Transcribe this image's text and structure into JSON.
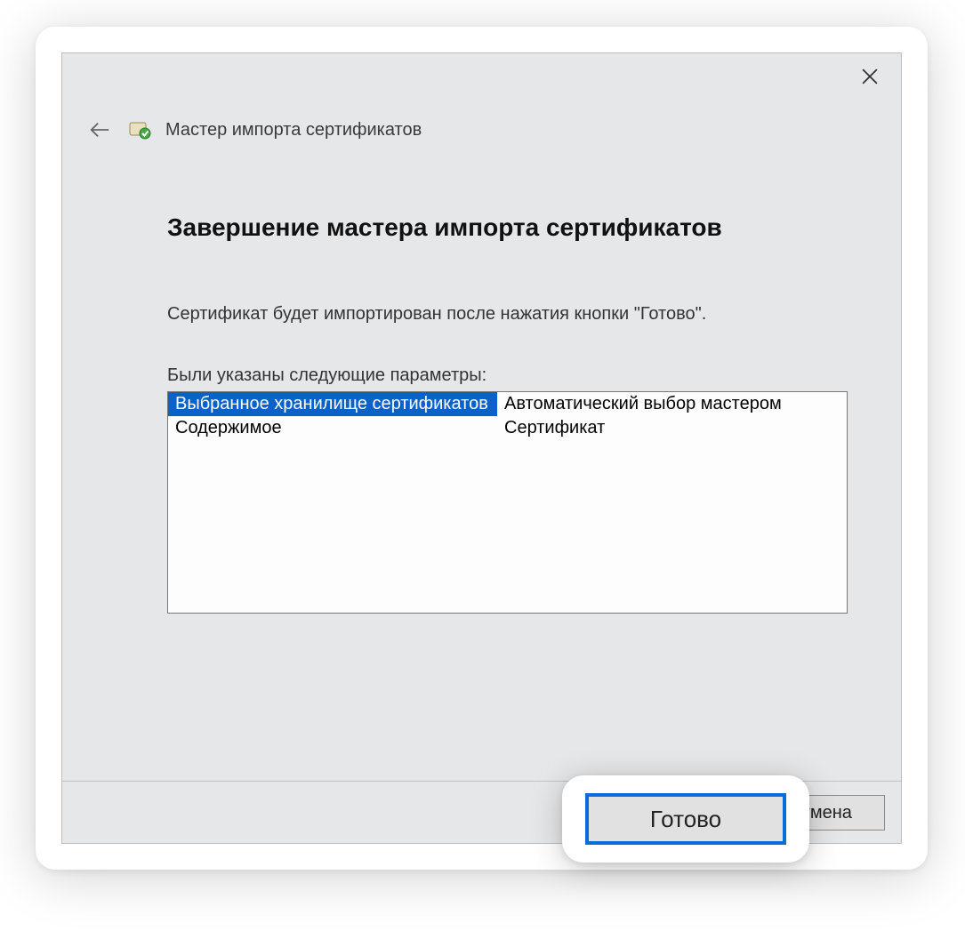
{
  "wizard": {
    "title": "Мастер импорта сертификатов",
    "heading": "Завершение мастера импорта сертификатов",
    "description": "Сертификат будет импортирован после нажатия кнопки \"Готово\".",
    "params_label": "Были указаны следующие параметры:",
    "params": [
      {
        "key": "Выбранное хранилище сертификатов",
        "value": "Автоматический выбор мастером",
        "selected": true
      },
      {
        "key": "Содержимое",
        "value": "Сертификат",
        "selected": false
      }
    ]
  },
  "buttons": {
    "finish": "Готово",
    "cancel": "Отмена"
  }
}
